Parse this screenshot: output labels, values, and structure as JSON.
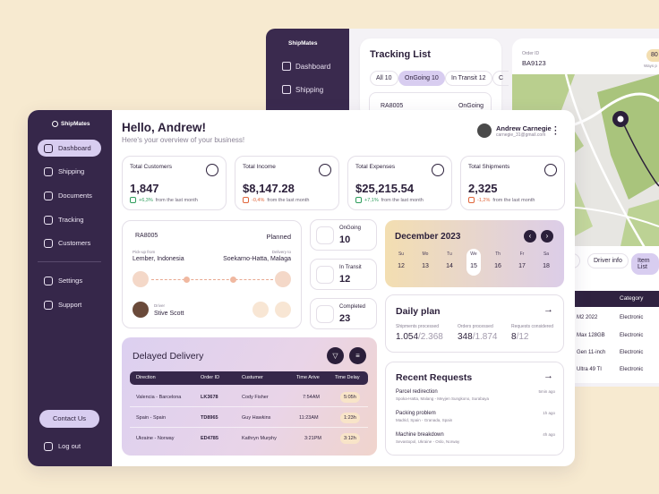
{
  "back": {
    "logo": "ShipMates",
    "nav": [
      "Dashboard",
      "Shipping"
    ],
    "tracking_title": "Tracking List",
    "tabs": [
      "All 10",
      "OnGoing 10",
      "In Transit 12",
      "C"
    ],
    "card_id": "RA8005",
    "card_status": "OnGoing",
    "order_id_label": "Order ID",
    "order_id": "BA9123",
    "badge": "80",
    "ways": "Ways p",
    "filter_pills": [
      "le",
      "Driver info",
      "Item List"
    ],
    "category_label": "Category",
    "items": [
      {
        "name": "M2 2022",
        "category": "Electronic"
      },
      {
        "name": "Max 128GB",
        "category": "Electronic"
      },
      {
        "name": "Gen 11-inch",
        "category": "Electronic"
      },
      {
        "name": "Ultra 49 TI",
        "category": "Electronic"
      }
    ]
  },
  "sidebar": {
    "logo": "ShipMates",
    "items": [
      "Dashboard",
      "Shipping",
      "Documents",
      "Tracking",
      "Customers"
    ],
    "bottom_items": [
      "Settings",
      "Support"
    ],
    "contact": "Contact Us",
    "logout": "Log out"
  },
  "header": {
    "greeting": "Hello, Andrew!",
    "subtitle": "Here's your overview of your business!",
    "user_name": "Andrew Carnegie",
    "user_email": "carnegie_31@gmail.com"
  },
  "stats": [
    {
      "label": "Total Customers",
      "value": "1,847",
      "change": "+6,3%",
      "note": "from the last month",
      "trend": "up"
    },
    {
      "label": "Total Income",
      "value": "$8,147.28",
      "change": "-0,4%",
      "note": "from the last month",
      "trend": "down"
    },
    {
      "label": "Total Expenses",
      "value": "$25,215.54",
      "change": "+7,1%",
      "note": "from the last month",
      "trend": "up"
    },
    {
      "label": "Total Shipments",
      "value": "2,325",
      "change": "-1,2%",
      "note": "from the last month",
      "trend": "down"
    }
  ],
  "shipment": {
    "id": "RA8005",
    "status": "Planned",
    "pickup_label": "Pick-up from",
    "pickup": "Lember, Indonesia",
    "delivery_label": "Delivery to",
    "delivery": "Soekarno-Hatta, Malaga",
    "driver_label": "Driver",
    "driver": "Stive Scott"
  },
  "summary": [
    {
      "label": "OnGoing",
      "value": "10"
    },
    {
      "label": "In Transit",
      "value": "12"
    },
    {
      "label": "Completed",
      "value": "23"
    }
  ],
  "calendar": {
    "month": "December 2023",
    "days": [
      {
        "name": "Su",
        "date": "12"
      },
      {
        "name": "Mo",
        "date": "13"
      },
      {
        "name": "Tu",
        "date": "14"
      },
      {
        "name": "We",
        "date": "15"
      },
      {
        "name": "Th",
        "date": "16"
      },
      {
        "name": "Fr",
        "date": "17"
      },
      {
        "name": "Sa",
        "date": "18"
      }
    ]
  },
  "daily_plan": {
    "title": "Daily plan",
    "cols": [
      {
        "label": "Shipments processed",
        "value": "1.054",
        "total": "/2.368"
      },
      {
        "label": "Orders processed",
        "value": "348",
        "total": "/1.874"
      },
      {
        "label": "Requests considered",
        "value": "8",
        "total": "/12"
      }
    ]
  },
  "requests": {
    "title": "Recent Requests",
    "items": [
      {
        "title": "Parcel redirection",
        "route": "Spoka-Hatta, Malang - Meyjen Sungkono, Surabaya",
        "time": "5min ago"
      },
      {
        "title": "Packing problem",
        "route": "Madrid, Spain - Granada, Spain",
        "time": "1h ago"
      },
      {
        "title": "Machine breakdown",
        "route": "Sevastopol, Ukraine - Oslo, Norway",
        "time": "4h ago"
      }
    ]
  },
  "delayed": {
    "title": "Delayed Delivery",
    "headers": [
      "Direction",
      "Order ID",
      "Custumer",
      "Time Arive",
      "Time Delay"
    ],
    "rows": [
      {
        "direction": "Valencia - Barcelona",
        "order": "LK3678",
        "customer": "Cody Fisher",
        "arrive": "7:54AM",
        "delay": "5:05h"
      },
      {
        "direction": "Spain - Spain",
        "order": "TD8965",
        "customer": "Guy Hawkins",
        "arrive": "11:23AM",
        "delay": "1:23h"
      },
      {
        "direction": "Ukraine - Norway",
        "order": "ED4785",
        "customer": "Kathryn Murphy",
        "arrive": "3:21PM",
        "delay": "3:12h"
      }
    ]
  },
  "colors": {
    "accent": "#d8cdf0",
    "sidebar": "#36274a",
    "warm": "#f3deb1"
  }
}
